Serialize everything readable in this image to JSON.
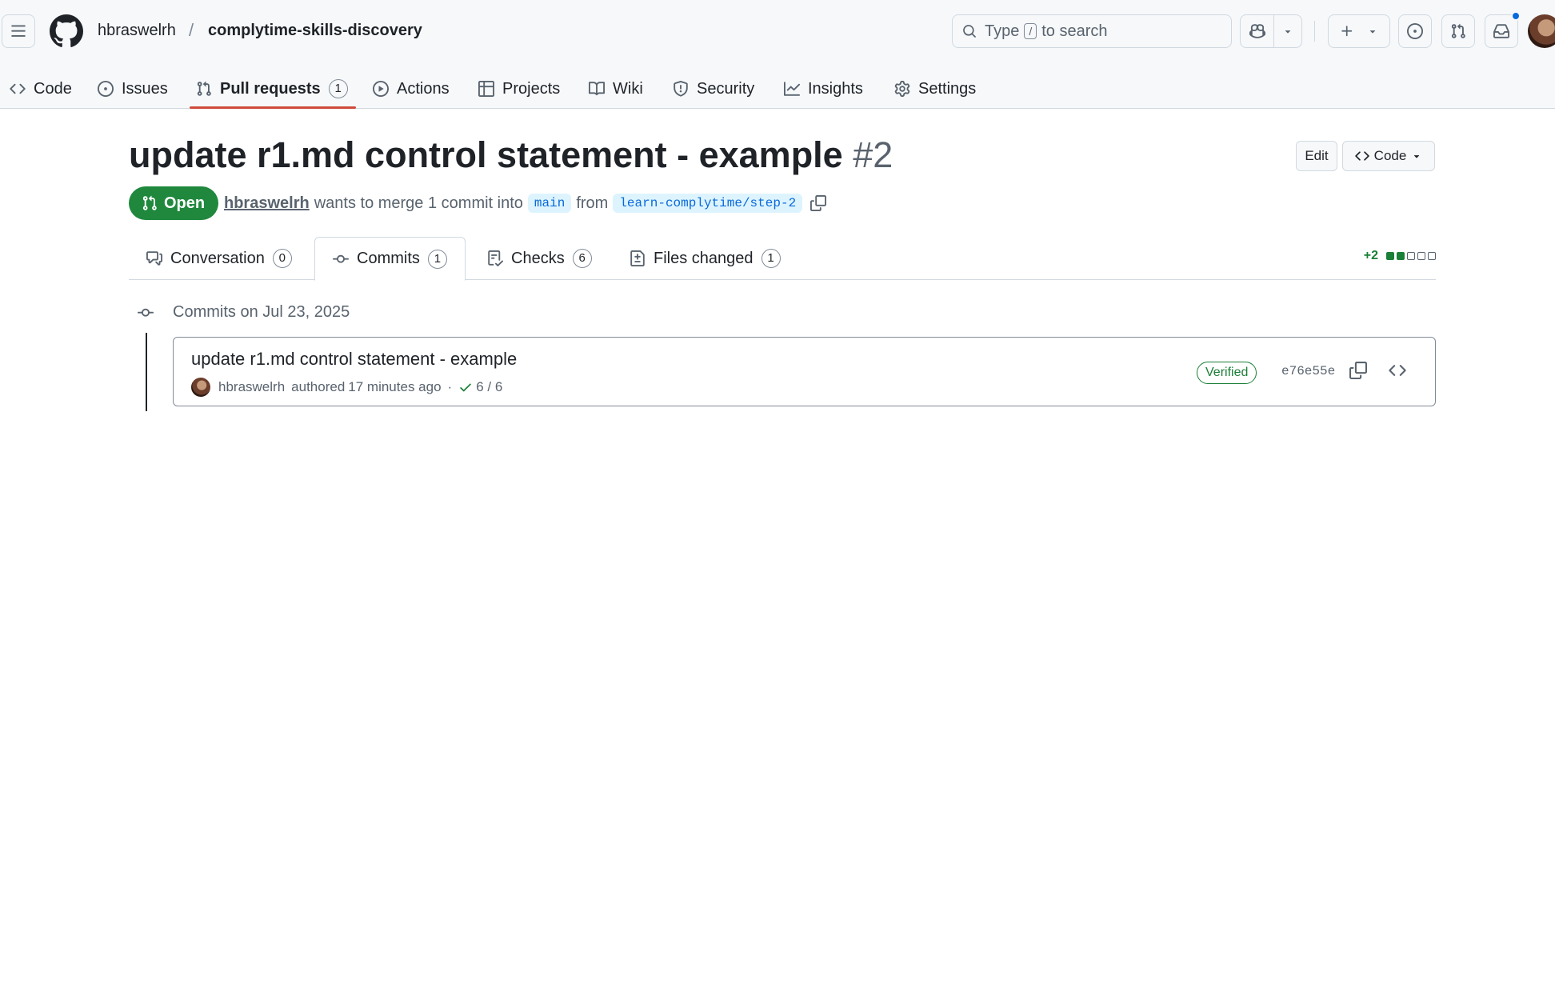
{
  "header": {
    "owner": "hbraswelrh",
    "separator": "/",
    "repo": "complytime-skills-discovery",
    "search": {
      "prefix": "Type",
      "key": "/",
      "suffix": "to search"
    }
  },
  "repo_nav": {
    "tabs": [
      {
        "label": "Code",
        "icon": "code-icon"
      },
      {
        "label": "Issues",
        "icon": "issue-opened-icon"
      },
      {
        "label": "Pull requests",
        "icon": "git-pull-request-icon",
        "count": "1",
        "selected": true
      },
      {
        "label": "Actions",
        "icon": "play-icon"
      },
      {
        "label": "Projects",
        "icon": "table-icon"
      },
      {
        "label": "Wiki",
        "icon": "book-icon"
      },
      {
        "label": "Security",
        "icon": "shield-icon"
      },
      {
        "label": "Insights",
        "icon": "graph-icon"
      },
      {
        "label": "Settings",
        "icon": "gear-icon"
      }
    ]
  },
  "pr": {
    "title": "update r1.md control statement - example",
    "number": "#2",
    "edit_label": "Edit",
    "code_label": "Code",
    "state": "Open",
    "author": "hbraswelrh",
    "merge_text": "wants to merge 1 commit into",
    "base_branch": "main",
    "from_text": "from",
    "head_branch": "learn-complytime/step-2",
    "tabs": [
      {
        "label": "Conversation",
        "count": "0"
      },
      {
        "label": "Commits",
        "count": "1",
        "selected": true
      },
      {
        "label": "Checks",
        "count": "6"
      },
      {
        "label": "Files changed",
        "count": "1"
      }
    ],
    "diffstat": {
      "additions": "+2",
      "green_blocks": 2,
      "total_blocks": 5
    }
  },
  "commits": {
    "group_date": "Commits on Jul 23, 2025",
    "items": [
      {
        "message": "update r1.md control statement - example",
        "author": "hbraswelrh",
        "authored": "authored",
        "time": "17 minutes ago",
        "dot": "·",
        "checks": "6 / 6",
        "verified": "Verified",
        "sha": "e76e55e"
      }
    ]
  },
  "colors": {
    "accent": "#0969da",
    "open_green": "#1f883d",
    "success": "#1a7f37",
    "tab_underline": "#cf4a3c",
    "muted": "#59636e"
  }
}
